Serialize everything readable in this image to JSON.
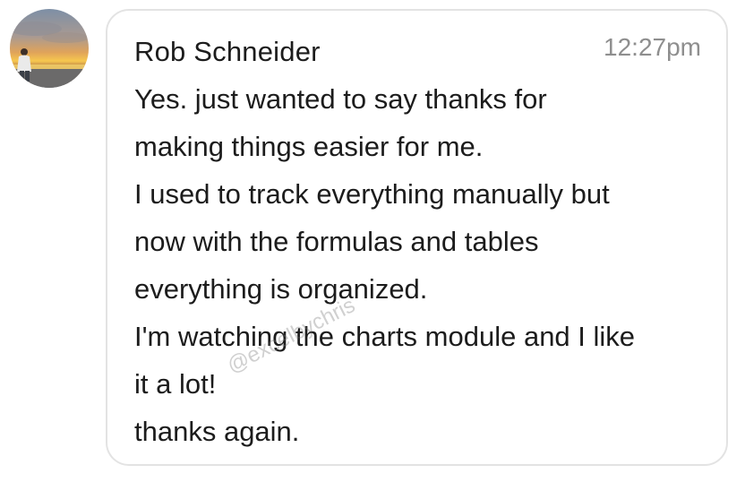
{
  "message": {
    "sender_name": "Rob Schneider",
    "timestamp": "12:27pm",
    "lines": [
      "Yes. just wanted to say thanks for",
      "making things easier for me.",
      "I used to track everything manually but",
      "now with the formulas and tables",
      "everything is organized.",
      "I'm watching the charts module and I like",
      "it a lot!",
      "thanks again."
    ]
  },
  "watermark": "@excelbychris",
  "colors": {
    "bubble_border": "#e3e3e3",
    "text": "#1c1c1c",
    "timestamp": "#8e8e8e"
  },
  "icons": {
    "avatar": "user-profile-photo-sunset"
  }
}
